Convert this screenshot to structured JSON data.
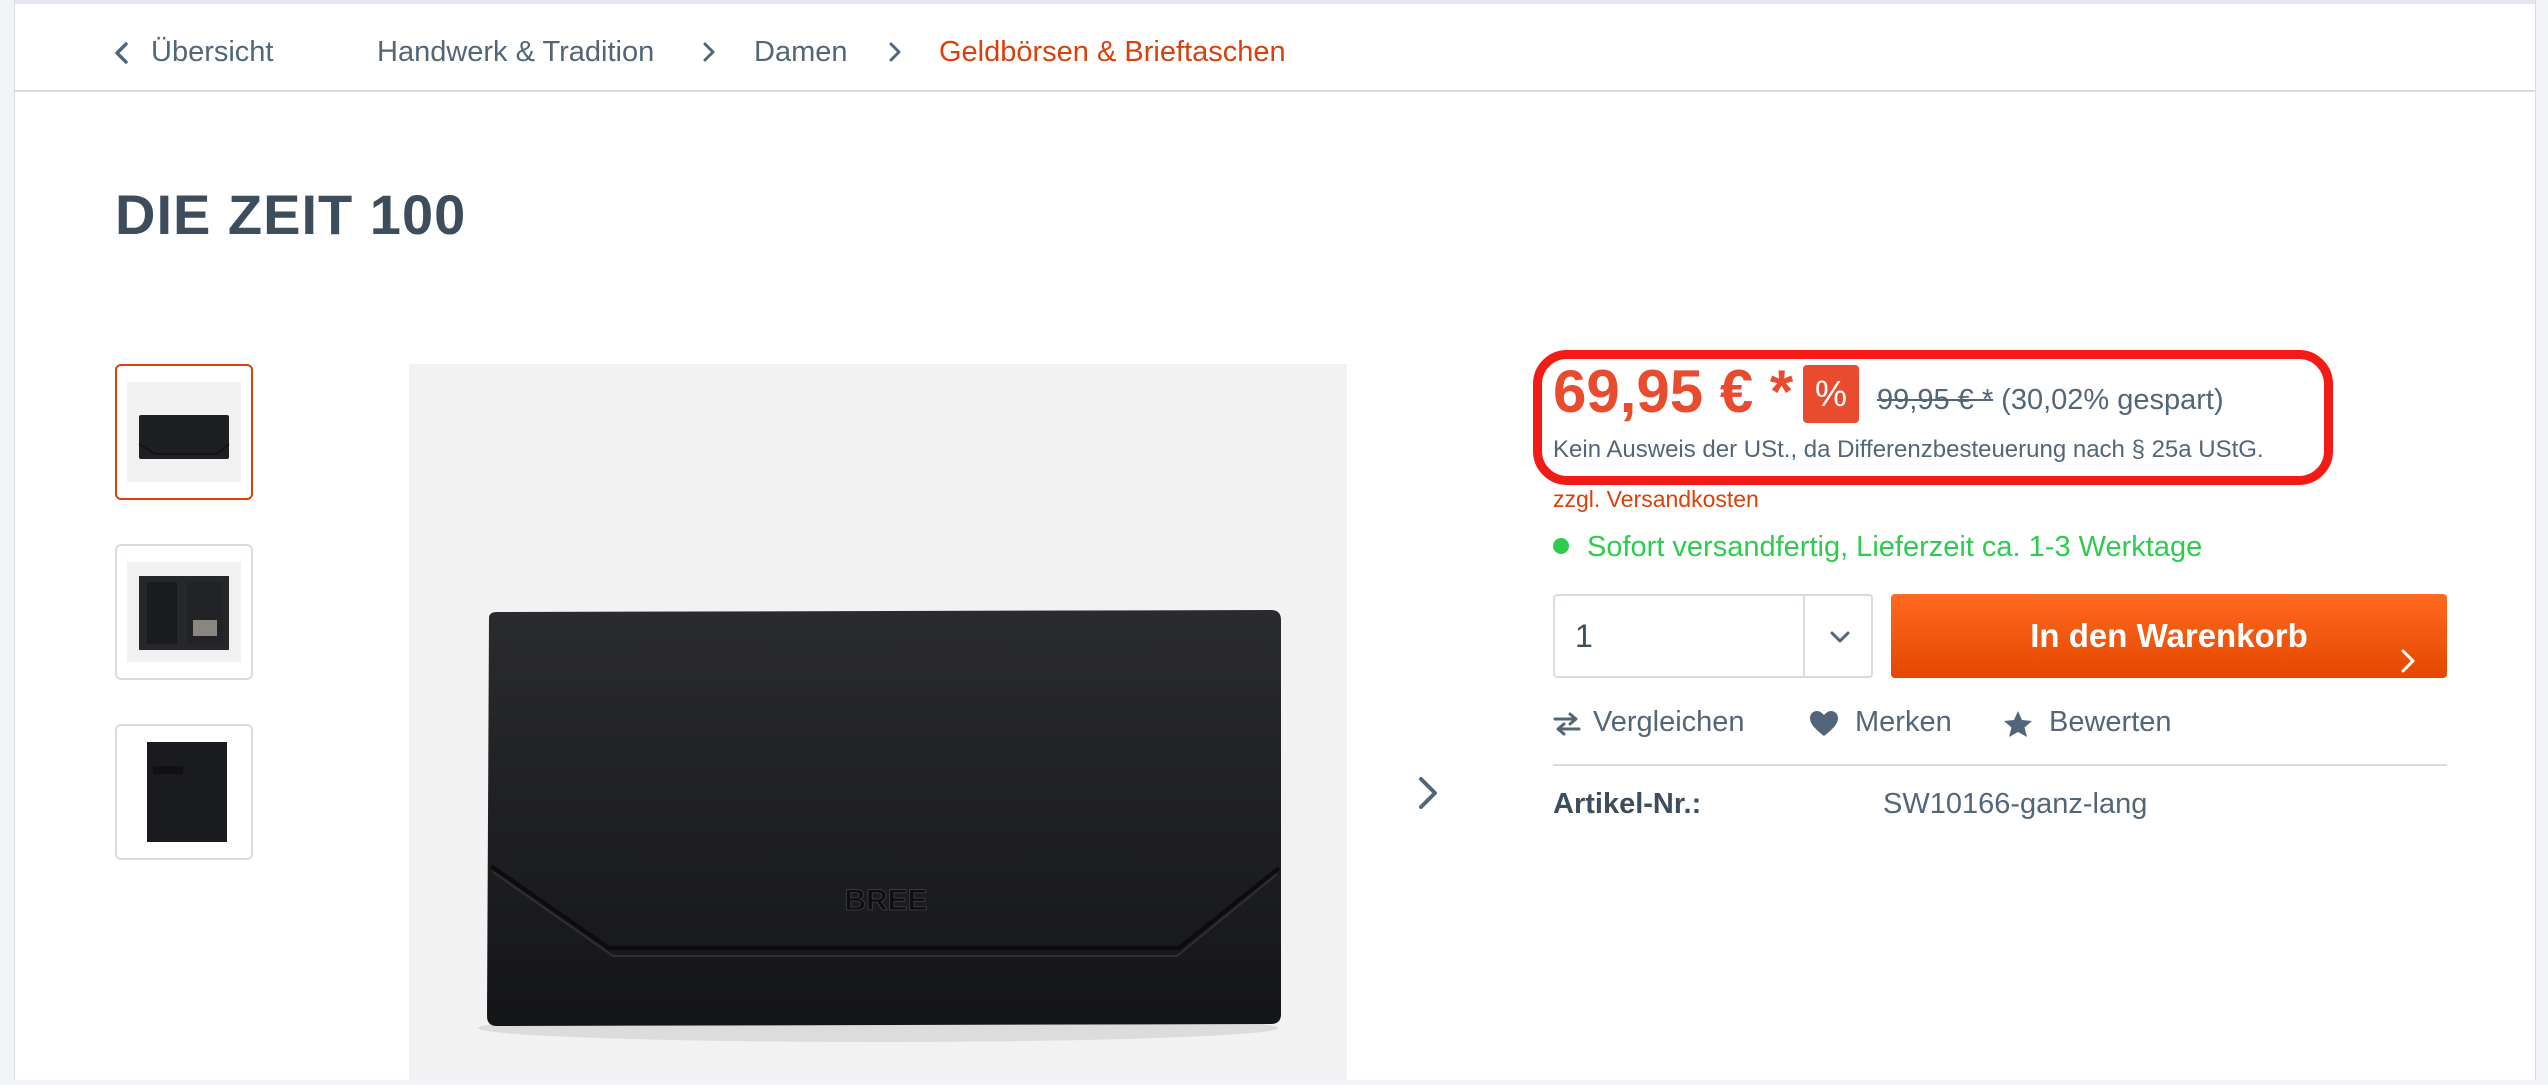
{
  "breadcrumb": {
    "back_label": "Übersicht",
    "items": [
      "Handwerk & Tradition",
      "Damen",
      "Geldbörsen & Brieftaschen"
    ]
  },
  "product": {
    "title": "DIE ZEIT 100",
    "thumbnails": [
      "thumb-1",
      "thumb-2",
      "thumb-3"
    ],
    "image_logo_text": "BREE"
  },
  "buybox": {
    "price": "69,95 € *",
    "discount_badge": "%",
    "old_price": "99,95 € *",
    "savings": "(30,02% gespart)",
    "vat_note": "Kein Ausweis der USt., da Differenzbesteuerung nach § 25a UStG.",
    "shipping_link": "zzgl. Versandkosten",
    "delivery": "Sofort versandfertig, Lieferzeit ca. 1-3 Werktage",
    "quantity": "1",
    "cart_button": "In den Warenkorb",
    "actions": {
      "compare": "Vergleichen",
      "wishlist": "Merken",
      "rate": "Bewerten"
    },
    "article_label": "Artikel-Nr.:",
    "article_value": "SW10166-ganz-lang"
  },
  "colors": {
    "accent": "#d9400b",
    "price": "#e84b2e",
    "success": "#2ecc4e",
    "highlight": "#f31b16"
  }
}
